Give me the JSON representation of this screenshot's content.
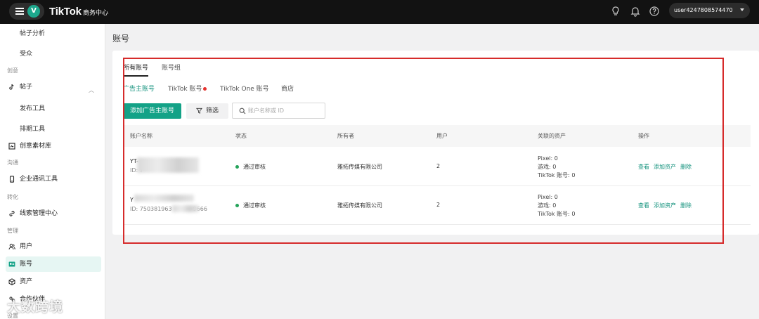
{
  "topbar": {
    "brand": "TikTok",
    "brand_sub": "商务中心",
    "avatar_letter": "V",
    "user": "user4247808574470",
    "icons": [
      "menu-icon",
      "lightbulb-icon",
      "bell-icon",
      "help-icon"
    ]
  },
  "sidebar": {
    "post_analysis": "帖子分析",
    "audience": "受众",
    "cat_creative": "创意",
    "posts": "帖子",
    "publish_tool": "发布工具",
    "schedule_tool": "排期工具",
    "creative_library": "创意素材库",
    "cat_communication": "沟通",
    "enterprise_comm": "企业通讯工具",
    "cat_conversion": "转化",
    "lead_center": "线索管理中心",
    "cat_management": "管理",
    "users": "用户",
    "accounts": "账号",
    "assets": "资产",
    "partners": "合作伙伴",
    "settings": "设置",
    "watermark": "大数跨境"
  },
  "main": {
    "page_title": "账号",
    "tabs": [
      "所有账号",
      "账号组"
    ],
    "subtabs": [
      "广告主账号",
      "TikTok 账号",
      "TikTok One 账号",
      "商店"
    ],
    "add_button": "添加广告主账号",
    "filter_button": "筛选",
    "search_placeholder": "账户名称或 ID"
  },
  "table": {
    "headers": [
      "账户名称",
      "状态",
      "所有者",
      "用户",
      "关联的资产",
      "操作"
    ],
    "rows": [
      {
        "name": "YT-",
        "id": "ID: 7",
        "status": "通过审核",
        "owner": "雅拓传媒有限公司",
        "users": "2",
        "assets": [
          "Pixel: 0",
          "游戏: 0",
          "TikTok 账号: 0"
        ],
        "actions": [
          "查看",
          "添加资产",
          "删除"
        ]
      },
      {
        "name": "Y",
        "id": "ID: 750381963",
        "id_tail": "9666",
        "status": "通过审核",
        "owner": "雅拓传媒有限公司",
        "users": "2",
        "assets": [
          "Pixel: 0",
          "游戏: 0",
          "TikTok 账号: 0"
        ],
        "actions": [
          "查看",
          "添加资产",
          "删除"
        ]
      }
    ]
  },
  "colors": {
    "accent": "#13a287",
    "status_ok": "#25a35a",
    "highlight_box": "#d62b2b",
    "topbar": "#121212"
  }
}
